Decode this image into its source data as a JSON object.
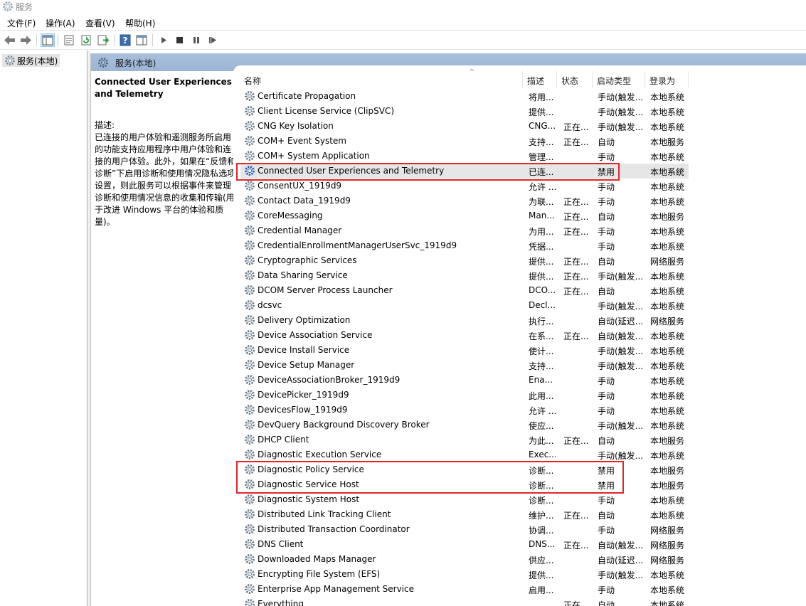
{
  "window": {
    "title": "服务"
  },
  "menu": [
    "文件(F)",
    "操作(A)",
    "查看(V)",
    "帮助(H)"
  ],
  "toolbar_icons": [
    "back-icon",
    "forward-icon",
    "show-hide-tree-icon",
    "properties-icon",
    "refresh-icon",
    "export-list-icon",
    "help-icon",
    "show-hide-action-pane-icon",
    "start-service-icon",
    "stop-service-icon",
    "pause-service-icon",
    "restart-service-icon"
  ],
  "tree": {
    "root_label": "服务(本地)"
  },
  "header": {
    "title": "服务(本地)"
  },
  "details": {
    "service_name": "Connected User Experiences and Telemetry",
    "description_label": "描述:",
    "description": "已连接的用户体验和遥测服务所启用的功能支持应用程序中用户体验和连接的用户体验。此外，如果在“反馈和诊断”下启用诊断和使用情况隐私选项设置，则此服务可以根据事件来管理诊断和使用情况信息的收集和传输(用于改进 Windows 平台的体验和质量)。"
  },
  "columns": [
    "名称",
    "描述",
    "状态",
    "启动类型",
    "登录为"
  ],
  "services": [
    {
      "name": "Certificate Propagation",
      "desc": "将用...",
      "status": "",
      "startup": "手动(触发...",
      "logon": "本地系统"
    },
    {
      "name": "Client License Service (ClipSVC)",
      "desc": "提供...",
      "status": "",
      "startup": "手动(触发...",
      "logon": "本地系统"
    },
    {
      "name": "CNG Key Isolation",
      "desc": "CNG...",
      "status": "正在...",
      "startup": "手动(触发...",
      "logon": "本地系统"
    },
    {
      "name": "COM+ Event System",
      "desc": "支持...",
      "status": "正在...",
      "startup": "自动",
      "logon": "本地服务"
    },
    {
      "name": "COM+ System Application",
      "desc": "管理...",
      "status": "",
      "startup": "手动",
      "logon": "本地系统"
    },
    {
      "name": "Connected User Experiences and Telemetry",
      "desc": "已连...",
      "status": "",
      "startup": "禁用",
      "logon": "本地系统",
      "selected": true
    },
    {
      "name": "ConsentUX_1919d9",
      "desc": "允许 ...",
      "status": "",
      "startup": "手动",
      "logon": "本地系统"
    },
    {
      "name": "Contact Data_1919d9",
      "desc": "为联...",
      "status": "正在...",
      "startup": "手动",
      "logon": "本地系统"
    },
    {
      "name": "CoreMessaging",
      "desc": "Man...",
      "status": "正在...",
      "startup": "自动",
      "logon": "本地服务"
    },
    {
      "name": "Credential Manager",
      "desc": "为用...",
      "status": "正在...",
      "startup": "手动",
      "logon": "本地系统"
    },
    {
      "name": "CredentialEnrollmentManagerUserSvc_1919d9",
      "desc": "凭据...",
      "status": "",
      "startup": "手动",
      "logon": "本地系统"
    },
    {
      "name": "Cryptographic Services",
      "desc": "提供...",
      "status": "正在...",
      "startup": "自动",
      "logon": "网络服务"
    },
    {
      "name": "Data Sharing Service",
      "desc": "提供...",
      "status": "正在...",
      "startup": "手动(触发...",
      "logon": "本地系统"
    },
    {
      "name": "DCOM Server Process Launcher",
      "desc": "DCO...",
      "status": "正在...",
      "startup": "自动",
      "logon": "本地系统"
    },
    {
      "name": "dcsvc",
      "desc": "Decl...",
      "status": "",
      "startup": "手动(触发...",
      "logon": "本地系统"
    },
    {
      "name": "Delivery Optimization",
      "desc": "执行...",
      "status": "",
      "startup": "自动(延迟...",
      "logon": "网络服务"
    },
    {
      "name": "Device Association Service",
      "desc": "在系...",
      "status": "正在...",
      "startup": "自动(触发...",
      "logon": "本地系统"
    },
    {
      "name": "Device Install Service",
      "desc": "使计...",
      "status": "",
      "startup": "手动(触发...",
      "logon": "本地系统"
    },
    {
      "name": "Device Setup Manager",
      "desc": "支持...",
      "status": "",
      "startup": "手动(触发...",
      "logon": "本地系统"
    },
    {
      "name": "DeviceAssociationBroker_1919d9",
      "desc": "Ena...",
      "status": "",
      "startup": "手动",
      "logon": "本地系统"
    },
    {
      "name": "DevicePicker_1919d9",
      "desc": "此用...",
      "status": "",
      "startup": "手动",
      "logon": "本地系统"
    },
    {
      "name": "DevicesFlow_1919d9",
      "desc": "允许 ...",
      "status": "",
      "startup": "手动",
      "logon": "本地系统"
    },
    {
      "name": "DevQuery Background Discovery Broker",
      "desc": "使应...",
      "status": "",
      "startup": "手动(触发...",
      "logon": "本地系统"
    },
    {
      "name": "DHCP Client",
      "desc": "为此...",
      "status": "正在...",
      "startup": "自动",
      "logon": "本地服务"
    },
    {
      "name": "Diagnostic Execution Service",
      "desc": "Exec...",
      "status": "",
      "startup": "手动(触发...",
      "logon": "本地系统"
    },
    {
      "name": "Diagnostic Policy Service",
      "desc": "诊断...",
      "status": "",
      "startup": "禁用",
      "logon": "本地服务"
    },
    {
      "name": "Diagnostic Service Host",
      "desc": "诊断...",
      "status": "",
      "startup": "禁用",
      "logon": "本地服务"
    },
    {
      "name": "Diagnostic System Host",
      "desc": "诊断...",
      "status": "",
      "startup": "手动",
      "logon": "本地系统"
    },
    {
      "name": "Distributed Link Tracking Client",
      "desc": "维护...",
      "status": "正在...",
      "startup": "自动",
      "logon": "本地系统"
    },
    {
      "name": "Distributed Transaction Coordinator",
      "desc": "协调...",
      "status": "",
      "startup": "手动",
      "logon": "网络服务"
    },
    {
      "name": "DNS Client",
      "desc": "DNS...",
      "status": "正在...",
      "startup": "自动(触发...",
      "logon": "网络服务"
    },
    {
      "name": "Downloaded Maps Manager",
      "desc": "供应...",
      "status": "",
      "startup": "自动(延迟...",
      "logon": "网络服务"
    },
    {
      "name": "Encrypting File System (EFS)",
      "desc": "提供...",
      "status": "",
      "startup": "手动(触发...",
      "logon": "本地系统"
    },
    {
      "name": "Enterprise App Management Service",
      "desc": "启用...",
      "status": "",
      "startup": "手动",
      "logon": "本地系统"
    },
    {
      "name": "Everything",
      "desc": "",
      "status": "正在...",
      "startup": "自动",
      "logon": "本地系统"
    }
  ],
  "colors": {
    "highlight": "#e0262b",
    "header_bg": "#a8c0dc",
    "selected_row": "#e6e6e6"
  }
}
